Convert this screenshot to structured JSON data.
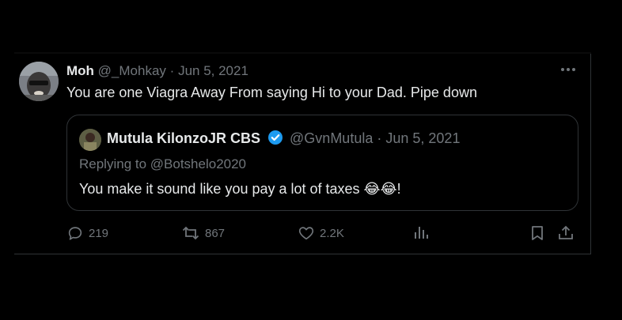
{
  "tweet": {
    "author_name": "Moh",
    "author_handle": "@_Mohkay",
    "separator": "·",
    "date": "Jun 5, 2021",
    "more_label": "•••",
    "text": "You are one Viagra Away From saying Hi to your Dad. Pipe down",
    "avatar_icon": "user-avatar"
  },
  "quoted": {
    "author_name": "Mutula KilonzoJR CBS",
    "verified_color": "#1d9bf0",
    "author_handle": "@GvnMutula",
    "separator": "·",
    "date": "Jun 5, 2021",
    "replying_to": "Replying to @Botshelo2020",
    "text": "You make it sound like you pay a lot of taxes 😂😂!",
    "avatar_icon": "user-avatar"
  },
  "actions": {
    "replies": "219",
    "retweets": "867",
    "likes": "2.2K"
  },
  "colors": {
    "background": "#000000",
    "text_primary": "#e7e9ea",
    "text_secondary": "#71767b",
    "border": "#2f3336"
  }
}
